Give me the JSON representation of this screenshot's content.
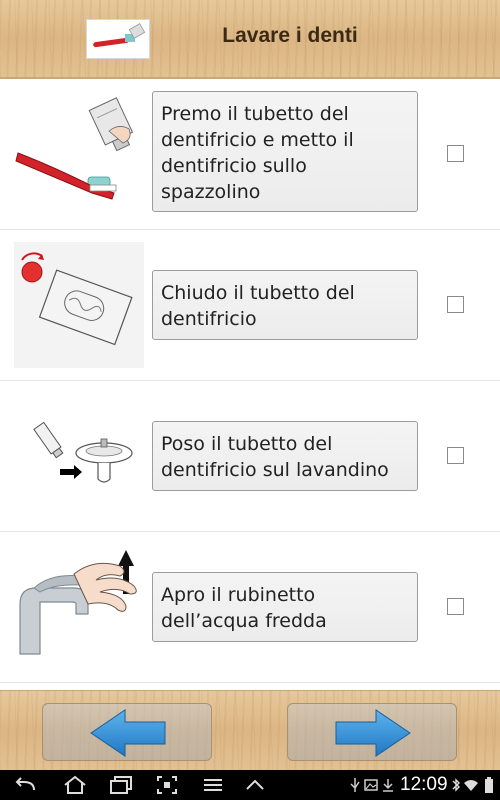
{
  "header": {
    "title": "Lavare i denti",
    "thumbnail_icon": "toothbrush-icon"
  },
  "steps": [
    {
      "text": "Premo il tubetto del dentifricio e metto il dentifricio sullo spazzolino",
      "icon": "toothpaste-on-brush-icon",
      "checked": false
    },
    {
      "text": "Chiudo il tubetto del dentifricio",
      "icon": "close-toothpaste-cap-icon",
      "checked": false
    },
    {
      "text": "Poso il tubetto del dentifricio sul lavandino",
      "icon": "toothpaste-to-sink-icon",
      "checked": false
    },
    {
      "text": "Apro il rubinetto dell’acqua fredda",
      "icon": "open-tap-icon",
      "checked": false
    }
  ],
  "footer": {
    "back_icon": "arrow-left-icon",
    "next_icon": "arrow-right-icon"
  },
  "system_bar": {
    "time": "12:09",
    "nav_icons": [
      "back-icon",
      "home-icon",
      "recent-apps-icon",
      "screenshot-icon",
      "menu-icon",
      "up-icon"
    ],
    "status_icons": [
      "usb-icon",
      "image-icon",
      "download-icon",
      "bluetooth-icon",
      "wifi-icon",
      "battery-icon"
    ]
  },
  "colors": {
    "accent_blue": "#2f8fd6",
    "toothbrush_red": "#d2232a",
    "wood": "#dcb684"
  }
}
